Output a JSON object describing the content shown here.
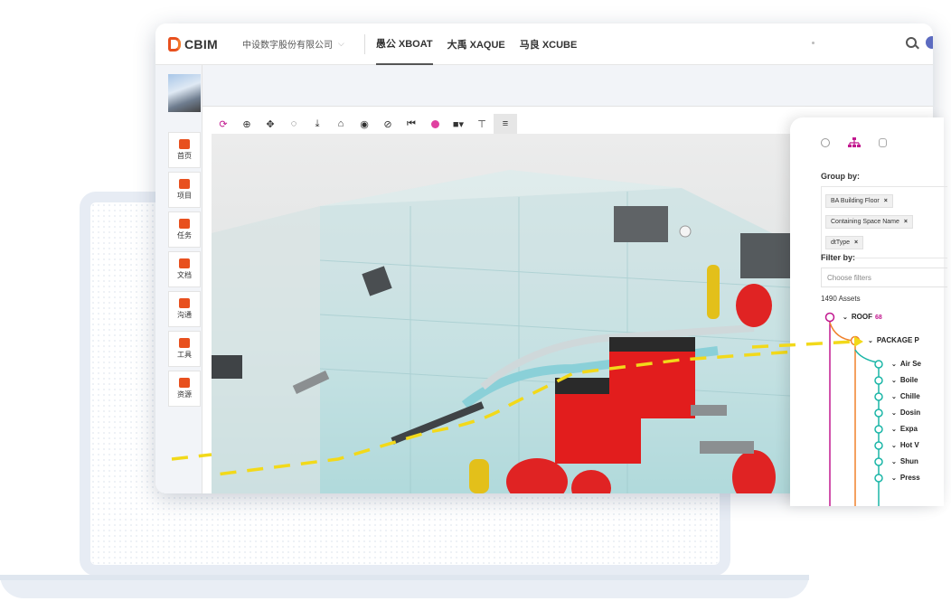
{
  "app": {
    "logo_text": "CBIM",
    "company": "中设数字股份有限公司",
    "tabs": [
      "愚公 XBOAT",
      "大禹 XAQUE",
      "马良 XCUBE"
    ],
    "active_tab_index": 0,
    "colors": {
      "brand": "#e8501e",
      "accent": "#c2188f",
      "tree_line_orange": "#f0812c",
      "tree_line_teal": "#1bb6a7",
      "highlight_path": "#f2d91a"
    }
  },
  "sidebar": {
    "items": [
      {
        "label": "首页",
        "icon": "home-icon"
      },
      {
        "label": "项目",
        "icon": "project-icon"
      },
      {
        "label": "任务",
        "icon": "task-icon"
      },
      {
        "label": "文档",
        "icon": "document-icon"
      },
      {
        "label": "沟通",
        "icon": "chat-icon"
      },
      {
        "label": "工具",
        "icon": "tools-icon"
      },
      {
        "label": "资源",
        "icon": "resource-icon"
      }
    ]
  },
  "toolbar": {
    "tools": [
      "refresh-icon",
      "zoom-icon",
      "pan-icon",
      "orbit-icon",
      "download-icon",
      "home-view-icon",
      "visibility-icon",
      "visibility-off-icon",
      "first-icon",
      "record-icon",
      "camera-icon",
      "filter-icon",
      "menu-icon"
    ]
  },
  "panel": {
    "group_by_label": "Group by:",
    "group_chips": [
      "BA Building Floor",
      "Containing Space Name",
      "dtType"
    ],
    "filter_label": "Filter by:",
    "filter_placeholder": "Choose filters",
    "assets_count": "1490 Assets",
    "tree": {
      "root": {
        "label": "ROOF",
        "count": "68"
      },
      "child": {
        "label": "PACKAGE P"
      },
      "leaves": [
        "Air Se",
        "Boile",
        "Chille",
        "Dosin",
        "Expa",
        "Hot V",
        "Shun",
        "Press"
      ]
    }
  }
}
